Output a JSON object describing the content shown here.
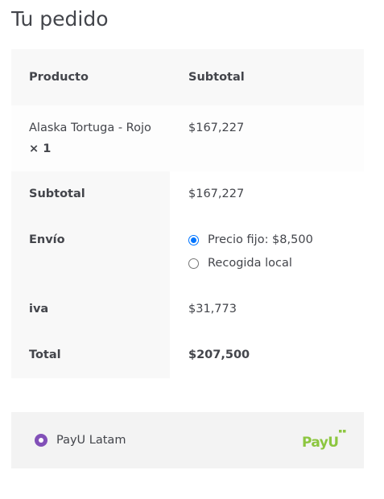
{
  "page_title": "Tu pedido",
  "table": {
    "headers": {
      "product": "Producto",
      "subtotal": "Subtotal"
    },
    "items": [
      {
        "name": "Alaska Tortuga - Rojo",
        "quantity": "× 1",
        "subtotal": "$167,227"
      }
    ],
    "footer": {
      "subtotal": {
        "label": "Subtotal",
        "value": "$167,227"
      },
      "shipping": {
        "label": "Envío",
        "options": [
          {
            "label": "Precio fijo: $8,500",
            "selected": true
          },
          {
            "label": "Recogida local",
            "selected": false
          }
        ]
      },
      "iva": {
        "label": "iva",
        "value": "$31,773"
      },
      "total": {
        "label": "Total",
        "value": "$207,500"
      }
    }
  },
  "payment": {
    "method_label": "PayU Latam",
    "selected": true,
    "logo": {
      "text": "PayU",
      "color": "#8cc63f"
    }
  },
  "colors": {
    "text": "#43454b",
    "accent_radio": "#8250b8",
    "checked_radio": "#0075ff"
  }
}
